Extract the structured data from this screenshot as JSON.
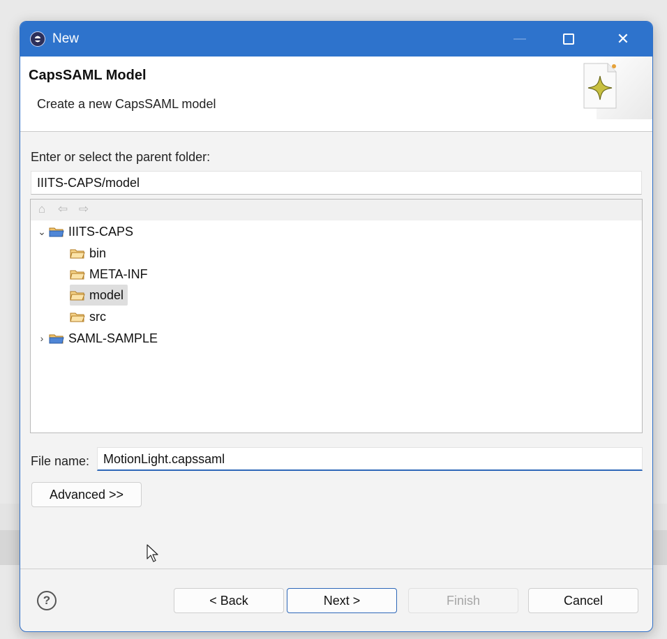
{
  "window": {
    "title": "New",
    "close_glyph": "✕"
  },
  "header": {
    "title": "CapsSAML Model",
    "description": "Create a new CapsSAML model"
  },
  "folder": {
    "label": "Enter or select the parent folder:",
    "value": "IIITS-CAPS/model"
  },
  "tree": {
    "items": [
      {
        "label": "IIITS-CAPS",
        "twisty": "⌄",
        "kind": "project"
      },
      {
        "label": "bin",
        "kind": "folder"
      },
      {
        "label": "META-INF",
        "kind": "folder"
      },
      {
        "label": "model",
        "kind": "folder",
        "selected": true
      },
      {
        "label": "src",
        "kind": "folder"
      },
      {
        "label": "SAML-SAMPLE",
        "twisty": "›",
        "kind": "project"
      }
    ],
    "toolbar": {
      "home": "⌂",
      "back": "⇦",
      "forward": "⇨"
    }
  },
  "file": {
    "label": "File name:",
    "value": "MotionLight.capssaml"
  },
  "buttons": {
    "advanced": "Advanced >>",
    "back": "< Back",
    "next": "Next >",
    "finish": "Finish",
    "cancel": "Cancel",
    "help": "?"
  },
  "colors": {
    "accent": "#2e73cc",
    "folder": "#e3a53a"
  }
}
